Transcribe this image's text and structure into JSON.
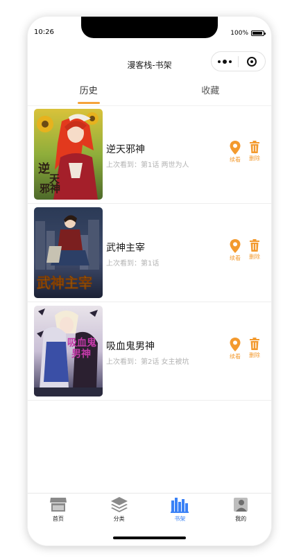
{
  "status_bar": {
    "time": "10:26",
    "battery": "100%"
  },
  "nav": {
    "title": "漫客栈-书架"
  },
  "tabs": [
    {
      "label": "历史",
      "active": true
    },
    {
      "label": "收藏",
      "active": false
    }
  ],
  "actions": {
    "continue_label": "续看",
    "delete_label": "删除",
    "accent_color": "#f39a2e"
  },
  "history": [
    {
      "title": "逆天邪神",
      "last_read": "上次看到：第1话 两世为人"
    },
    {
      "title": "武神主宰",
      "last_read": "上次看到：第1话"
    },
    {
      "title": "吸血鬼男神",
      "last_read": "上次看到：第2话 女主被坑"
    }
  ],
  "tabbar": [
    {
      "label": "首页",
      "icon": "store-icon",
      "active": false
    },
    {
      "label": "分类",
      "icon": "layers-icon",
      "active": false
    },
    {
      "label": "书架",
      "icon": "bookshelf-icon",
      "active": true
    },
    {
      "label": "我的",
      "icon": "user-icon",
      "active": false
    }
  ],
  "colors": {
    "active_tab_underline": "#f5a33a",
    "tabbar_active": "#3b82f6"
  }
}
